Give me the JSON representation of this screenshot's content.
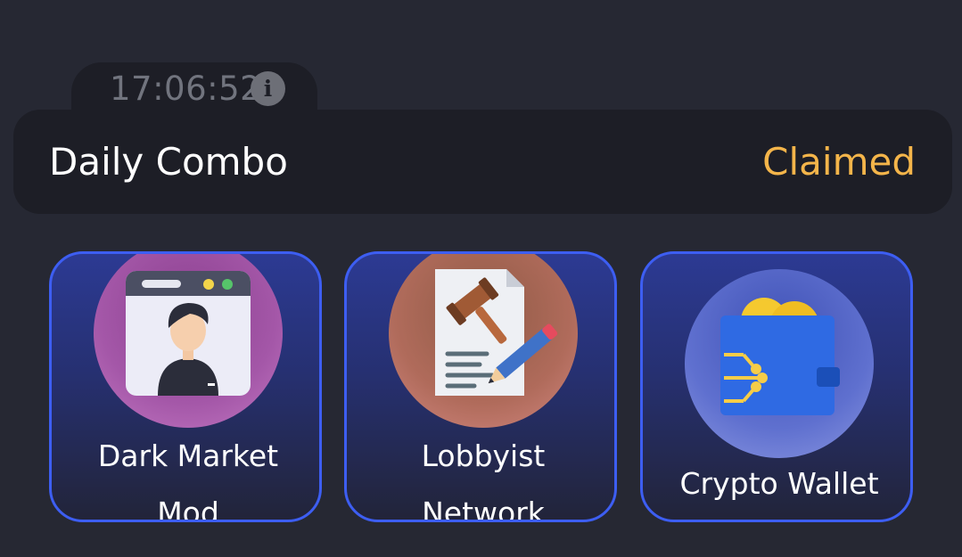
{
  "timer": {
    "value": "17:06:52",
    "info_glyph": "i"
  },
  "combo": {
    "title": "Daily Combo",
    "status": "Claimed",
    "status_color": "#f4b54a"
  },
  "cards": [
    {
      "line1": "Dark Market",
      "line2": "Mod",
      "icon": "browser-user-icon"
    },
    {
      "line1": "Lobbyist",
      "line2": "Network",
      "icon": "gavel-document-icon"
    },
    {
      "line1": "Crypto Wallet",
      "line2": "",
      "icon": "crypto-wallet-icon"
    }
  ],
  "colors": {
    "background": "#262833",
    "panel": "#1d1e26",
    "card_border": "#3d5ef2"
  }
}
